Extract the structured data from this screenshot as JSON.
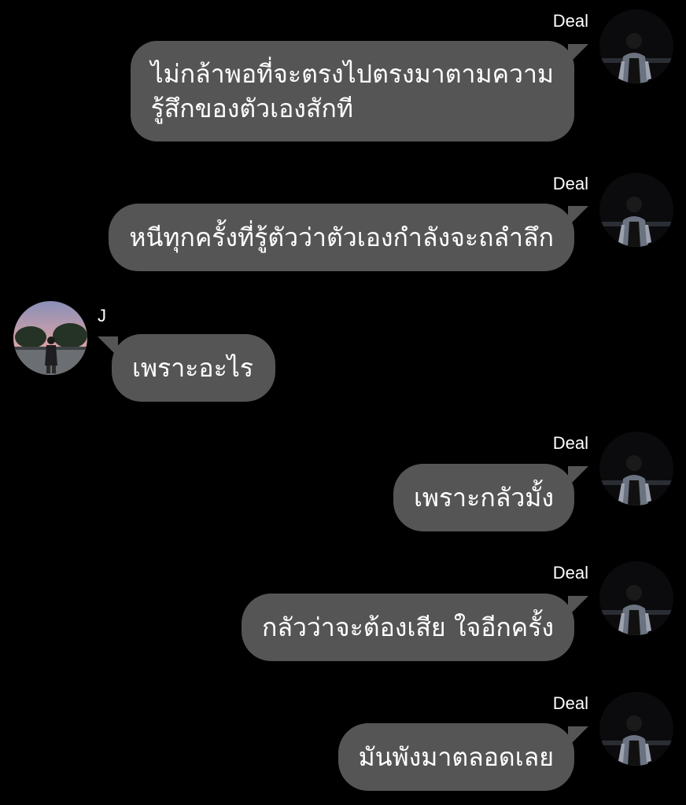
{
  "messages": [
    {
      "sender": "Deal",
      "lines": [
        "ไม่กล้าพอที่จะตรงไปตรงมาตามความ",
        "รู้สึกของตัวเองสักที"
      ]
    },
    {
      "sender": "Deal",
      "lines": [
        "หนีทุกครั้งที่รู้ตัวว่าตัวเองกำลังจะถลำลึก"
      ]
    },
    {
      "sender": "J",
      "lines": [
        "เพราะอะไร"
      ]
    },
    {
      "sender": "Deal",
      "lines": [
        "เพราะกลัวมั้ง"
      ]
    },
    {
      "sender": "Deal",
      "lines": [
        "กลัวว่าจะต้องเสีย ใจอีกครั้ง"
      ]
    },
    {
      "sender": "Deal",
      "lines": [
        "มันพังมาตลอดเลย"
      ]
    }
  ],
  "colors": {
    "background": "#000000",
    "bubble": "#555555",
    "text": "#ffffff"
  },
  "icons": {
    "deal_avatar": "avatar-deal-photo",
    "j_avatar": "avatar-j-sunset-photo"
  }
}
